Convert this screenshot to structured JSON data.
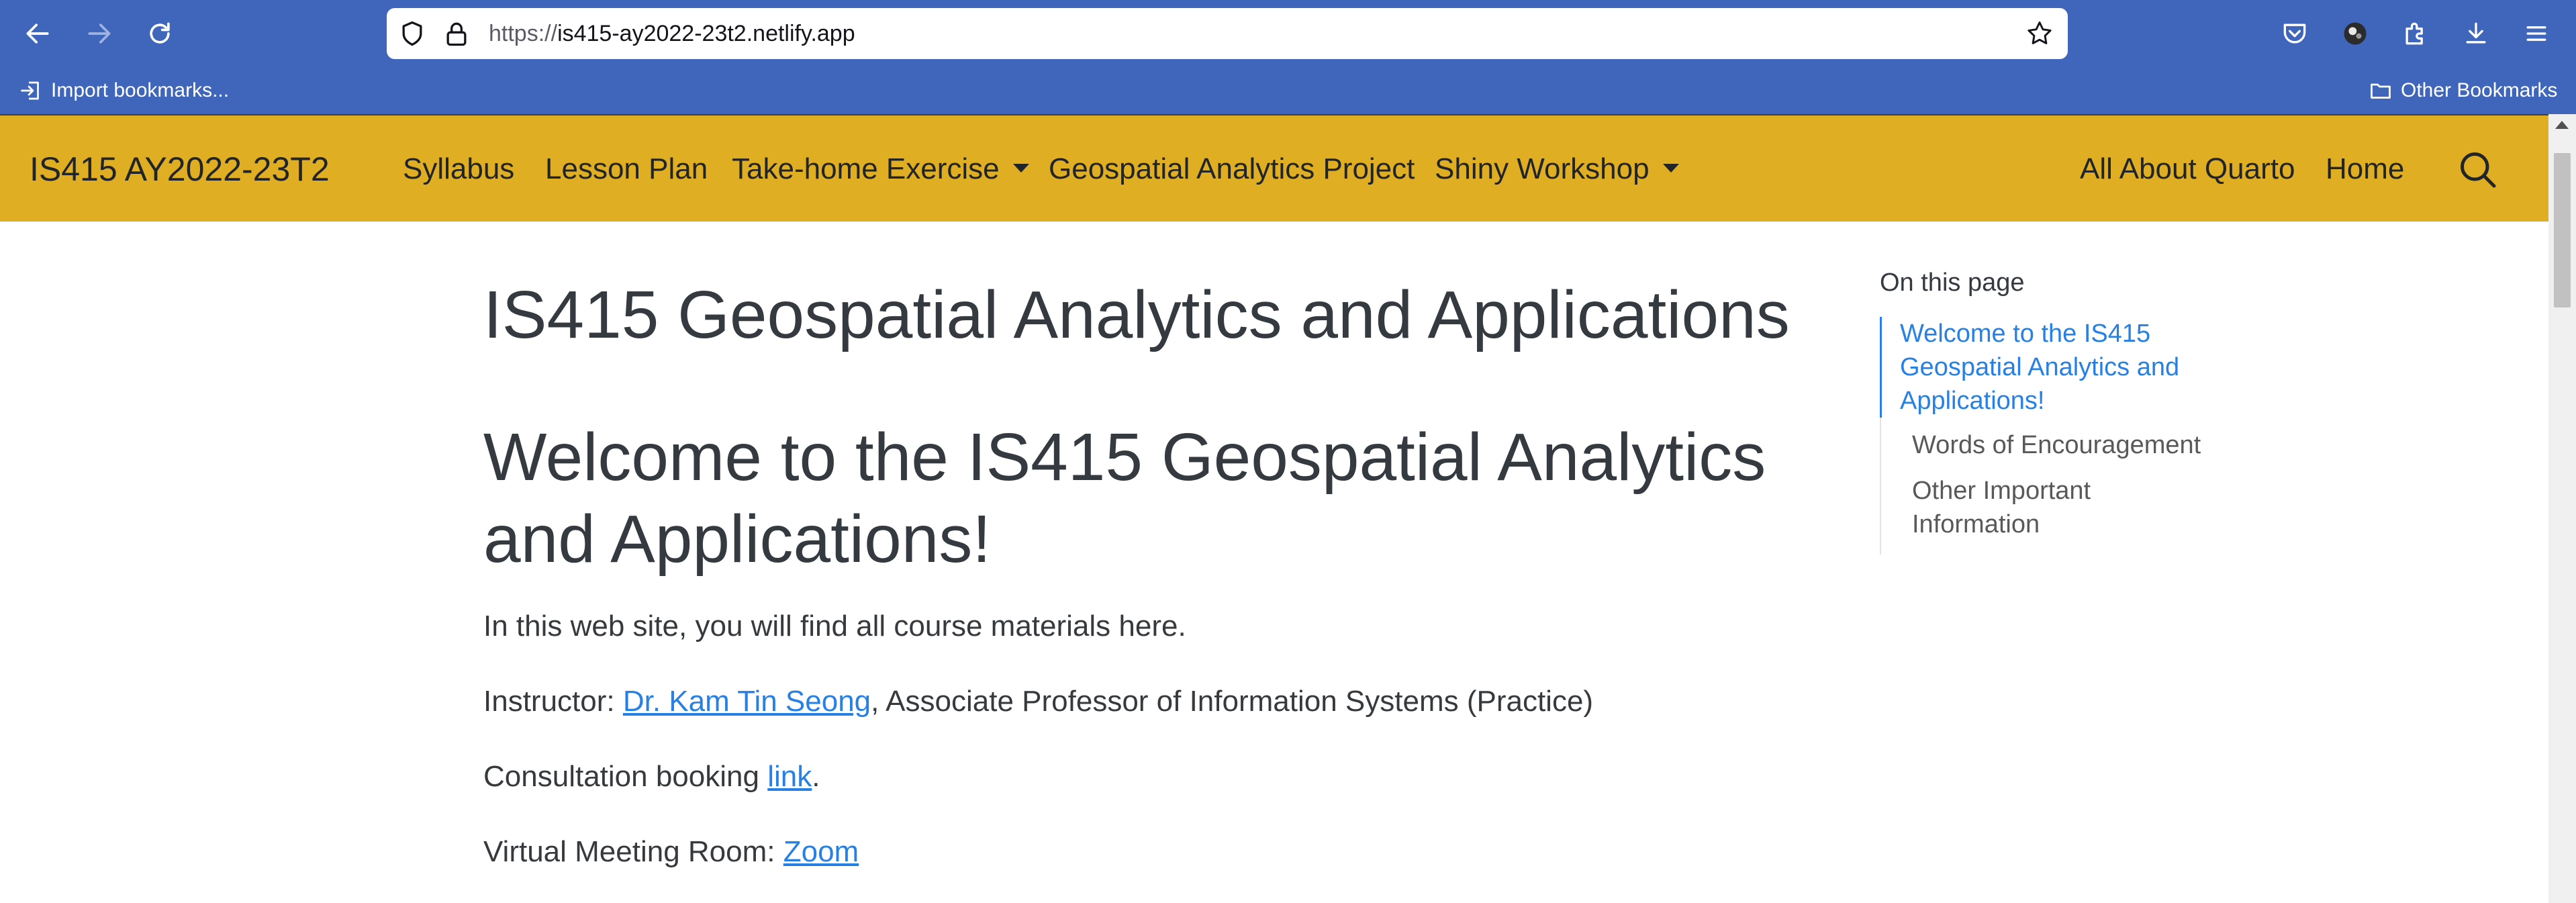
{
  "browser": {
    "url_protocol": "https://",
    "url_host": "is415-ay2022-23t2.netlify.app",
    "bookmarks": {
      "import_label": "Import bookmarks...",
      "other_label": "Other Bookmarks"
    }
  },
  "site": {
    "brand": "IS415 AY2022-23T2",
    "nav_left": [
      "Syllabus",
      "Lesson Plan",
      "Take-home Exercise",
      "Geospatial Analytics Project",
      "Shiny Workshop"
    ],
    "nav_right": [
      "All About Quarto",
      "Home"
    ]
  },
  "main": {
    "title": "IS415 Geospatial Analytics and Applications",
    "heading": "Welcome to the IS415 Geospatial Analytics and Applications!",
    "intro": "In this web site, you will find all course materials here.",
    "instructor_prefix": "Instructor: ",
    "instructor_link": "Dr. Kam Tin Seong",
    "instructor_suffix": ", Associate Professor of Information Systems (Practice)",
    "consult_prefix": "Consultation booking ",
    "consult_link": "link",
    "consult_suffix": ".",
    "meeting_prefix": "Virtual Meeting Room: ",
    "meeting_link": "Zoom"
  },
  "toc": {
    "title": "On this page",
    "items": [
      "Welcome to the IS415 Geospatial Analytics and Applications!",
      "Words of Encouragement",
      "Other Important Information"
    ]
  },
  "colors": {
    "chrome": "#3f66ba",
    "navbar": "#e0ae22",
    "link": "#2780e3",
    "heading": "#343a40"
  }
}
